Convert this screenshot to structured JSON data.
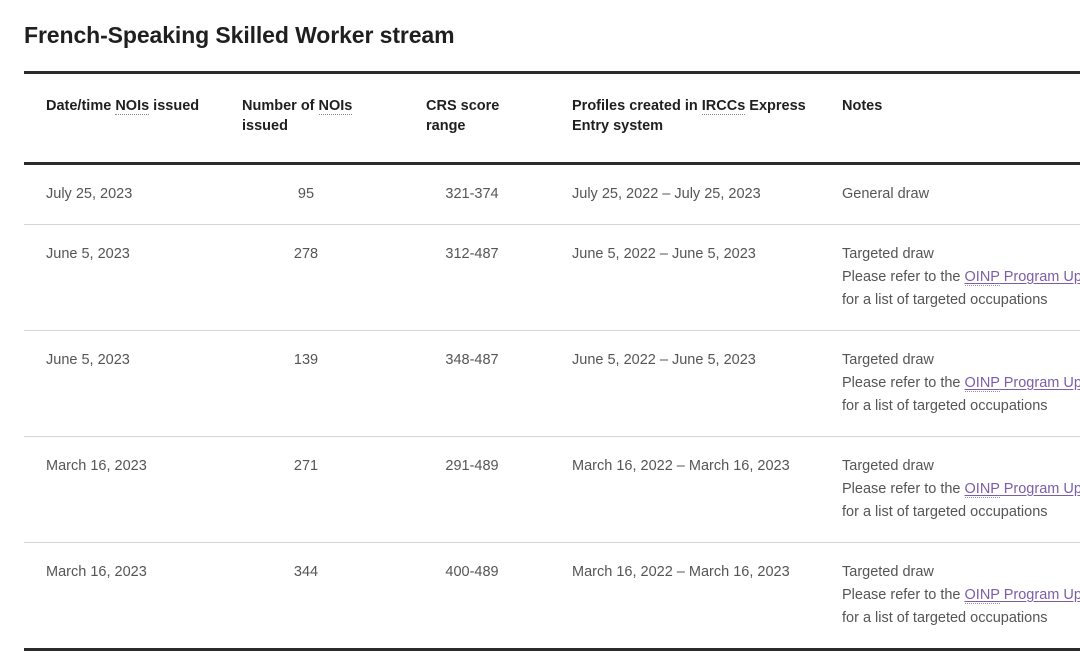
{
  "page_title": "French-Speaking Skilled Worker stream",
  "table": {
    "headers": [
      {
        "pre": "Date/time ",
        "abbr": "NOIs",
        "post": " issued",
        "name": "date-time-nois-issued"
      },
      {
        "pre": "Number of ",
        "abbr": "NOIs",
        "post": " issued",
        "name": "number-of-nois-issued"
      },
      {
        "pre": "CRS score range",
        "abbr": "",
        "post": "",
        "name": "crs-score-range"
      },
      {
        "pre": "Profiles created in ",
        "abbr": "IRCCs",
        "post": " Express Entry system",
        "name": "profiles-created-ircc"
      },
      {
        "pre": "Notes",
        "abbr": "",
        "post": "",
        "name": "notes"
      }
    ],
    "rows": [
      {
        "date": "July 25, 2023",
        "count": "95",
        "crs": "321-374",
        "profiles": "July 25, 2022 – July 25, 2023",
        "note_type": "General draw",
        "note_prefix": "",
        "link_abbr": "",
        "link_rest": "",
        "note_suffix": ""
      },
      {
        "date": "June 5, 2023",
        "count": "278",
        "crs": "312-487",
        "profiles": "June 5, 2022 – June 5, 2023",
        "note_type": "Targeted draw",
        "note_prefix": "Please refer to the ",
        "link_abbr": "OINP",
        "link_rest": " Program Update page",
        "note_suffix": " for a list of targeted occupations"
      },
      {
        "date": "June 5, 2023",
        "count": "139",
        "crs": "348-487",
        "profiles": "June 5, 2022 – June 5, 2023",
        "note_type": "Targeted draw",
        "note_prefix": "Please refer to the ",
        "link_abbr": "OINP",
        "link_rest": " Program Update page",
        "note_suffix": " for a list of targeted occupations"
      },
      {
        "date": "March 16, 2023",
        "count": "271",
        "crs": "291-489",
        "profiles": "March 16, 2022 – March 16, 2023",
        "note_type": "Targeted draw",
        "note_prefix": "Please refer to the ",
        "link_abbr": "OINP",
        "link_rest": " Program Update page",
        "note_suffix": " for a list of targeted occupations"
      },
      {
        "date": "March 16, 2023",
        "count": "344",
        "crs": "400-489",
        "profiles": "March 16, 2022 – March 16, 2023",
        "note_type": "Targeted draw",
        "note_prefix": "Please refer to the ",
        "link_abbr": "OINP",
        "link_rest": " Program Update page",
        "note_suffix": " for a list of targeted occupations"
      }
    ]
  },
  "colors": {
    "link": "#7b5ea7",
    "border_strong": "#2b2b2b",
    "border_light": "#d4d4d4",
    "body_text": "#555555",
    "heading_text": "#1f1f1f"
  }
}
